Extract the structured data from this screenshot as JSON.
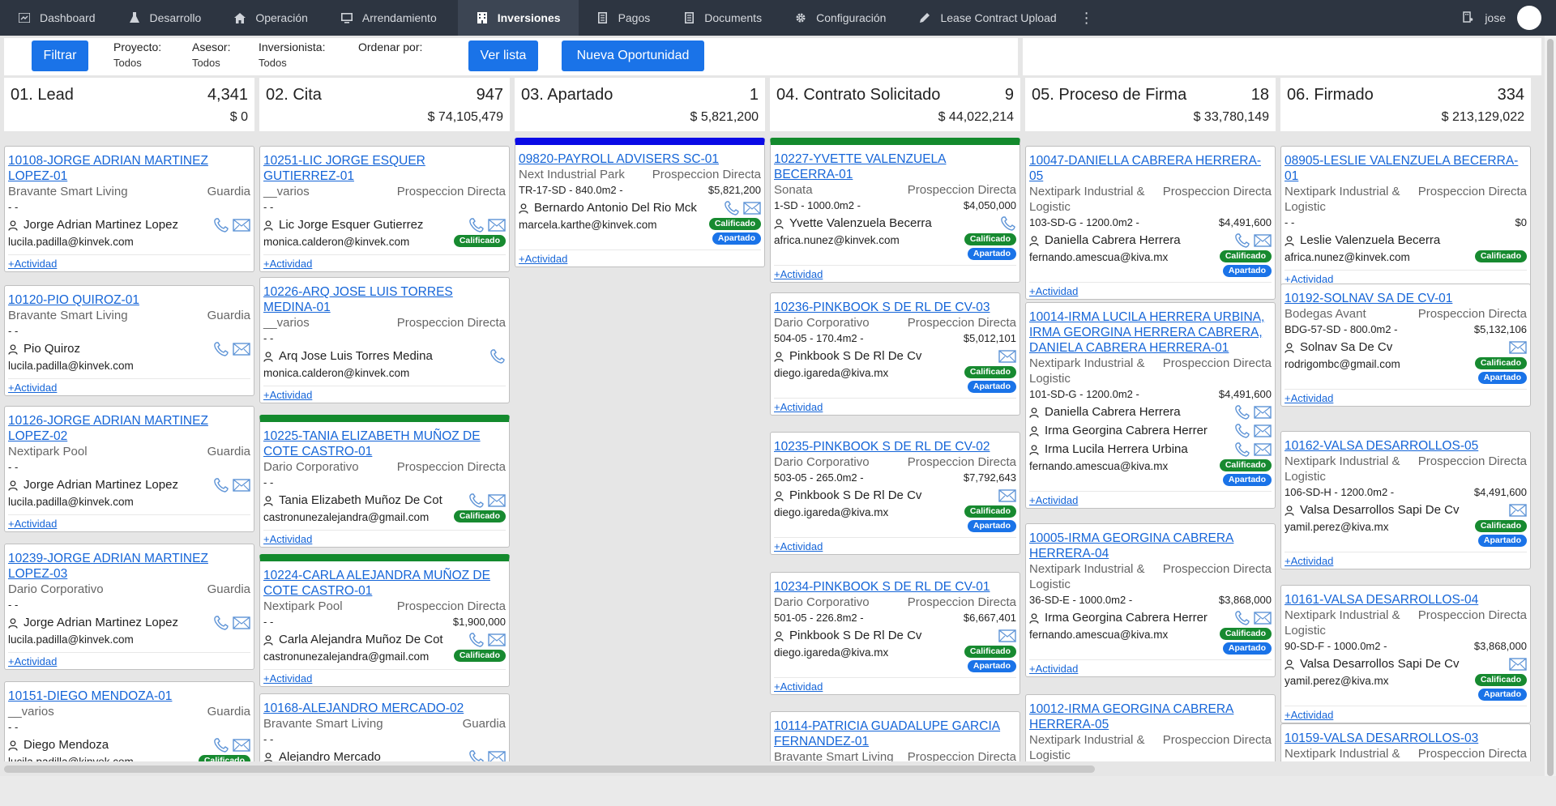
{
  "nav": {
    "items": [
      {
        "label": "Dashboard",
        "icon": "dashboard-icon"
      },
      {
        "label": "Desarrollo",
        "icon": "flask-icon"
      },
      {
        "label": "Operación",
        "icon": "home-icon"
      },
      {
        "label": "Arrendamiento",
        "icon": "monitor-icon"
      },
      {
        "label": "Inversiones",
        "icon": "building-icon",
        "active": true
      },
      {
        "label": "Pagos",
        "icon": "receipt-icon"
      },
      {
        "label": "Documents",
        "icon": "receipt-icon"
      },
      {
        "label": "Configuración",
        "icon": "gear-icon"
      },
      {
        "label": "Lease Contract Upload",
        "icon": "pen-icon"
      }
    ],
    "user": "jose"
  },
  "filters": {
    "filter_btn": "Filtrar",
    "proyecto_label": "Proyecto:",
    "proyecto_value": "Todos",
    "asesor_label": "Asesor:",
    "asesor_value": "Todos",
    "inversionista_label": "Inversionista:",
    "inversionista_value": "Todos",
    "ordenar_label": "Ordenar por:",
    "ver_lista": "Ver lista",
    "nueva": "Nueva Oportunidad"
  },
  "actividad": "+Actividad",
  "columns": [
    {
      "title": "01. Lead",
      "count": "4,341",
      "total": "$ 0",
      "cards": [
        {
          "title": [
            "10108-JORGE ADRIAN MARTINEZ",
            "LOPEZ-01"
          ],
          "project": "Bravante Smart Living",
          "source": "Guardia",
          "unit": "- -",
          "price": "",
          "people": [
            {
              "name": "Jorge Adrian Martinez Lopez",
              "phone": true,
              "mail": true
            }
          ],
          "email": "lucila.padilla@kinvek.com",
          "badges": []
        },
        {
          "title": [
            "10120-PIO QUIROZ-01"
          ],
          "project": "Bravante Smart Living",
          "source": "Guardia",
          "unit": "- -",
          "price": "",
          "people": [
            {
              "name": "Pio Quiroz",
              "phone": true,
              "mail": true
            }
          ],
          "email": "lucila.padilla@kinvek.com",
          "badges": []
        },
        {
          "title": [
            "10126-JORGE ADRIAN MARTINEZ",
            "LOPEZ-02"
          ],
          "project": "Nextipark Pool",
          "source": "Guardia",
          "unit": "- -",
          "price": "",
          "people": [
            {
              "name": "Jorge Adrian Martinez Lopez",
              "phone": true,
              "mail": true
            }
          ],
          "email": "lucila.padilla@kinvek.com",
          "badges": []
        },
        {
          "title": [
            "10239-JORGE ADRIAN MARTINEZ",
            "LOPEZ-03"
          ],
          "project": "Dario Corporativo",
          "source": "Guardia",
          "unit": "- -",
          "price": "",
          "people": [
            {
              "name": "Jorge Adrian Martinez Lopez",
              "phone": true,
              "mail": true
            }
          ],
          "email": "lucila.padilla@kinvek.com",
          "badges": []
        },
        {
          "title": [
            "10151-DIEGO MENDOZA-01"
          ],
          "project": "__varios",
          "source": "Guardia",
          "unit": "- -",
          "price": "",
          "people": [
            {
              "name": "Diego Mendoza",
              "phone": true,
              "mail": true
            }
          ],
          "email": "lucila.padilla@kinvek.com",
          "badges": [
            "Calificado"
          ]
        }
      ]
    },
    {
      "title": "02. Cita",
      "count": "947",
      "total": "$ 74,105,479",
      "cards": [
        {
          "title": [
            "10251-LIC JORGE ESQUER",
            "GUTIERREZ-01"
          ],
          "project": "__varios",
          "source": "Prospeccion Directa",
          "unit": "- -",
          "price": "",
          "people": [
            {
              "name": "Lic Jorge Esquer Gutierrez",
              "phone": true,
              "mail": true
            }
          ],
          "email": "monica.calderon@kinvek.com",
          "badges": [
            "Calificado"
          ]
        },
        {
          "title": [
            "10226-ARQ JOSE LUIS TORRES",
            "MEDINA-01"
          ],
          "project": "__varios",
          "source": "Prospeccion Directa",
          "unit": "- -",
          "price": "",
          "people": [
            {
              "name": "Arq Jose Luis Torres Medina",
              "phone": true,
              "mail": false
            }
          ],
          "email": "monica.calderon@kinvek.com",
          "badges": []
        },
        {
          "title": [
            "10225-TANIA ELIZABETH MUÑOZ DE",
            "COTE CASTRO-01"
          ],
          "project": "Dario Corporativo",
          "source": "Prospeccion Directa",
          "unit": "- -",
          "price": "",
          "people": [
            {
              "name": "Tania Elizabeth Muñoz De Cot",
              "phone": true,
              "mail": true
            }
          ],
          "email": "castronunezalejandra@gmail.com",
          "badges": [
            "Calificado"
          ],
          "stripe": "green"
        },
        {
          "title": [
            "10224-CARLA ALEJANDRA MUÑOZ DE",
            "COTE CASTRO-01"
          ],
          "project": "Nextipark Pool",
          "source": "Prospeccion Directa",
          "unit": "- -",
          "price": "$1,900,000",
          "people": [
            {
              "name": "Carla Alejandra Muñoz De Cot",
              "phone": true,
              "mail": true
            }
          ],
          "email": "castronunezalejandra@gmail.com",
          "badges": [
            "Calificado"
          ],
          "stripe": "green"
        },
        {
          "title": [
            "10168-ALEJANDRO MERCADO-02"
          ],
          "project": "Bravante Smart Living",
          "source": "Guardia",
          "unit": "- -",
          "price": "",
          "people": [
            {
              "name": "Alejandro Mercado",
              "phone": true,
              "mail": true
            }
          ],
          "email": "",
          "badges": []
        }
      ]
    },
    {
      "title": "03. Apartado",
      "count": "1",
      "total": "$ 5,821,200",
      "cards": [
        {
          "title": [
            "09820-PAYROLL ADVISERS SC-01"
          ],
          "project": "Next Industrial Park",
          "source": "Prospeccion Directa",
          "unit": "TR-17-SD - 840.0m2 -",
          "price": "$5,821,200",
          "people": [
            {
              "name": "Bernardo Antonio Del Rio Mck",
              "phone": true,
              "mail": true
            }
          ],
          "email": "marcela.karthe@kinvek.com",
          "badges": [
            "Calificado",
            "Apartado"
          ],
          "stripe": "blue"
        }
      ]
    },
    {
      "title": "04. Contrato Solicitado",
      "count": "9",
      "total": "$ 44,022,214",
      "cards": [
        {
          "title": [
            "10227-YVETTE VALENZUELA",
            "BECERRA-01"
          ],
          "project": "Sonata",
          "source": "Prospeccion Directa",
          "unit": "1-SD - 1000.0m2 -",
          "price": "$4,050,000",
          "people": [
            {
              "name": "Yvette Valenzuela Becerra",
              "phone": true,
              "mail": false
            }
          ],
          "email": "africa.nunez@kinvek.com",
          "badges": [
            "Calificado",
            "Apartado"
          ],
          "stripe": "green"
        },
        {
          "title": [
            "10236-PINKBOOK S DE RL DE CV-03"
          ],
          "project": "Dario Corporativo",
          "source": "Prospeccion Directa",
          "unit": "504-05 - 170.4m2 -",
          "price": "$5,012,101",
          "people": [
            {
              "name": "Pinkbook S De Rl De Cv",
              "phone": false,
              "mail": true
            }
          ],
          "email": "diego.igareda@kiva.mx",
          "badges": [
            "Calificado",
            "Apartado"
          ]
        },
        {
          "title": [
            "10235-PINKBOOK S DE RL DE CV-02"
          ],
          "project": "Dario Corporativo",
          "source": "Prospeccion Directa",
          "unit": "503-05 - 265.0m2 -",
          "price": "$7,792,643",
          "people": [
            {
              "name": "Pinkbook S De Rl De Cv",
              "phone": false,
              "mail": true
            }
          ],
          "email": "diego.igareda@kiva.mx",
          "badges": [
            "Calificado",
            "Apartado"
          ]
        },
        {
          "title": [
            "10234-PINKBOOK S DE RL DE CV-01"
          ],
          "project": "Dario Corporativo",
          "source": "Prospeccion Directa",
          "unit": "501-05 - 226.8m2 -",
          "price": "$6,667,401",
          "people": [
            {
              "name": "Pinkbook S De Rl De Cv",
              "phone": false,
              "mail": true
            }
          ],
          "email": "diego.igareda@kiva.mx",
          "badges": [
            "Calificado",
            "Apartado"
          ]
        },
        {
          "title": [
            "10114-PATRICIA GUADALUPE GARCIA",
            "FERNANDEZ-01"
          ],
          "project": "Bravante Smart Living",
          "source": "Prospeccion Directa",
          "unit": "",
          "price": "",
          "people": [],
          "email": "",
          "badges": []
        }
      ]
    },
    {
      "title": "05. Proceso de Firma",
      "count": "18",
      "total": "$ 33,780,149",
      "cards": [
        {
          "title": [
            "10047-DANIELLA CABRERA HERRERA-05"
          ],
          "project": "Nextipark Industrial &",
          "source": "Prospeccion Directa",
          "project2": "Logistic",
          "unit": "103-SD-G - 1200.0m2 -",
          "price": "$4,491,600",
          "people": [
            {
              "name": "Daniella Cabrera Herrera",
              "phone": true,
              "mail": true
            }
          ],
          "email": "fernando.amescua@kiva.mx",
          "badges": [
            "Calificado",
            "Apartado"
          ]
        },
        {
          "title": [
            "10014-IRMA LUCILA HERRERA URBINA,",
            "IRMA GEORGINA HERRERA CABRERA,",
            "DANIELA CABRERA HERRERA-01"
          ],
          "project": "Nextipark Industrial &",
          "source": "Prospeccion Directa",
          "project2": "Logistic",
          "unit": "101-SD-G - 1200.0m2 -",
          "price": "$4,491,600",
          "people": [
            {
              "name": "Daniella Cabrera Herrera",
              "phone": true,
              "mail": true
            },
            {
              "name": "Irma Georgina Cabrera Herrer",
              "phone": true,
              "mail": true
            },
            {
              "name": "Irma Lucila Herrera Urbina",
              "phone": true,
              "mail": true
            }
          ],
          "email": "fernando.amescua@kiva.mx",
          "badges": [
            "Calificado",
            "Apartado"
          ]
        },
        {
          "title": [
            "10005-IRMA GEORGINA CABRERA",
            "HERRERA-04"
          ],
          "project": "Nextipark Industrial &",
          "source": "Prospeccion Directa",
          "project2": "Logistic",
          "unit": "36-SD-E - 1000.0m2 -",
          "price": "$3,868,000",
          "people": [
            {
              "name": "Irma Georgina Cabrera Herrer",
              "phone": true,
              "mail": true
            }
          ],
          "email": "fernando.amescua@kiva.mx",
          "badges": [
            "Calificado",
            "Apartado"
          ]
        },
        {
          "title": [
            "10012-IRMA GEORGINA CABRERA",
            "HERRERA-05"
          ],
          "project": "Nextipark Industrial &",
          "source": "Prospeccion Directa",
          "project2": "Logistic",
          "unit": "",
          "price": "",
          "people": [],
          "email": "",
          "badges": []
        }
      ]
    },
    {
      "title": "06. Firmado",
      "count": "334",
      "total": "$ 213,129,022",
      "cards": [
        {
          "title": [
            "08905-LESLIE VALENZUELA BECERRA-01"
          ],
          "project": "Nextipark Industrial &",
          "source": "Prospeccion Directa",
          "project2": "Logistic",
          "unit": "- -",
          "price": "$0",
          "people": [
            {
              "name": "Leslie Valenzuela Becerra",
              "phone": false,
              "mail": false
            }
          ],
          "email": "africa.nunez@kinvek.com",
          "badges": [
            "Calificado"
          ]
        },
        {
          "title": [
            "10192-SOLNAV SA DE CV-01"
          ],
          "project": "Bodegas Avant",
          "source": "Prospeccion Directa",
          "unit": "BDG-57-SD - 800.0m2 -",
          "price": "$5,132,106",
          "people": [
            {
              "name": "Solnav Sa De Cv",
              "phone": false,
              "mail": true
            }
          ],
          "email": "rodrigombc@gmail.com",
          "badges": [
            "Calificado",
            "Apartado"
          ]
        },
        {
          "title": [
            "10162-VALSA DESARROLLOS-05"
          ],
          "project": "Nextipark Industrial &",
          "source": "Prospeccion Directa",
          "project2": "Logistic",
          "unit": "106-SD-H - 1200.0m2 -",
          "price": "$4,491,600",
          "people": [
            {
              "name": "Valsa Desarrollos Sapi De Cv",
              "phone": false,
              "mail": true
            }
          ],
          "email": "yamil.perez@kiva.mx",
          "badges": [
            "Calificado",
            "Apartado"
          ]
        },
        {
          "title": [
            "10161-VALSA DESARROLLOS-04"
          ],
          "project": "Nextipark Industrial &",
          "source": "Prospeccion Directa",
          "project2": "Logistic",
          "unit": "90-SD-F - 1000.0m2 -",
          "price": "$3,868,000",
          "people": [
            {
              "name": "Valsa Desarrollos Sapi De Cv",
              "phone": false,
              "mail": true
            }
          ],
          "email": "yamil.perez@kiva.mx",
          "badges": [
            "Calificado",
            "Apartado"
          ]
        },
        {
          "title": [
            "10159-VALSA DESARROLLOS-03"
          ],
          "project": "Nextipark Industrial &",
          "source": "Prospeccion Directa",
          "unit": "",
          "price": "",
          "people": [],
          "email": "",
          "badges": []
        }
      ]
    }
  ],
  "colors": {
    "nav_bg": "#2d3541",
    "link": "#1565d8",
    "accent": "#1a73e8",
    "green": "#178a30"
  }
}
